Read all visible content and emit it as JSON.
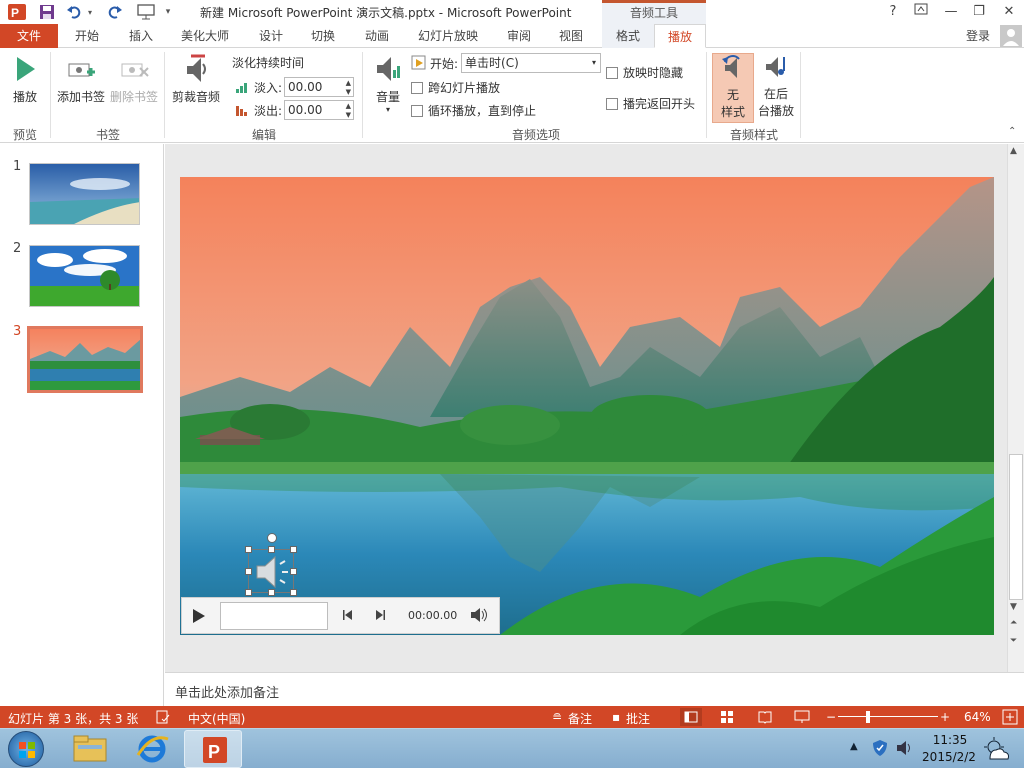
{
  "window": {
    "title": "新建 Microsoft PowerPoint 演示文稿.pptx - Microsoft PowerPoint",
    "context_group": "音频工具",
    "help": "?",
    "login": "登录"
  },
  "tabs": [
    {
      "label": "文件"
    },
    {
      "label": "开始"
    },
    {
      "label": "插入"
    },
    {
      "label": "美化大师"
    },
    {
      "label": "设计"
    },
    {
      "label": "切换"
    },
    {
      "label": "动画"
    },
    {
      "label": "幻灯片放映"
    },
    {
      "label": "审阅"
    },
    {
      "label": "视图"
    },
    {
      "label": "格式"
    },
    {
      "label": "播放"
    }
  ],
  "ribbon": {
    "preview": {
      "play": "播放",
      "group": "预览"
    },
    "bookmarks": {
      "add": "添加书签",
      "remove": "删除书签",
      "group": "书签"
    },
    "edit": {
      "trim": "剪裁音频",
      "fade_title": "淡化持续时间",
      "fade_in_label": "淡入:",
      "fade_in_value": "00.00",
      "fade_out_label": "淡出:",
      "fade_out_value": "00.00",
      "group": "编辑"
    },
    "audio_options": {
      "volume": "音量",
      "start_label": "开始:",
      "start_value": "单击时(C)",
      "cross_slides": "跨幻灯片播放",
      "loop": "循环播放，直到停止",
      "hide": "放映时隐藏",
      "rewind": "播完返回开头",
      "group": "音频选项"
    },
    "audio_styles": {
      "no_style_l1": "无",
      "no_style_l2": "样式",
      "bg_play_l1": "在后",
      "bg_play_l2": "台播放",
      "group": "音频样式"
    }
  },
  "slides": [
    {
      "number": "1"
    },
    {
      "number": "2"
    },
    {
      "number": "3"
    }
  ],
  "media_bar": {
    "time": "00:00.00"
  },
  "notes": {
    "placeholder": "单击此处添加备注"
  },
  "status": {
    "slide_info": "幻灯片 第 3 张，共 3 张",
    "language": "中文(中国)",
    "notes_btn": "备注",
    "comments_btn": "批注",
    "zoom": "64%"
  },
  "taskbar": {
    "time": "11:35",
    "date": "2015/2/2"
  },
  "colors": {
    "accent": "#d24726",
    "ribbon_bg": "#ffffff",
    "selected_style": "#f5c9b4"
  }
}
